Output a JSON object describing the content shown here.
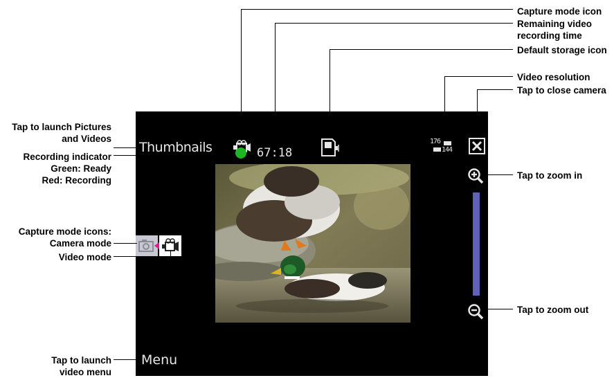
{
  "screen": {
    "thumbnails_label": "Thumbnails",
    "remaining_time": "67:18",
    "resolution_top": "176",
    "resolution_bottom": "144",
    "menu_label": "Menu",
    "recording_indicator_color": "#1db523",
    "zoom_bar_color": "#5f62b6"
  },
  "callouts": {
    "capture_mode_icon": "Capture mode icon",
    "remaining_time": "Remaining video\nrecording time",
    "default_storage": "Default storage icon",
    "video_resolution": "Video resolution",
    "close_camera": "Tap to close camera",
    "launch_pictures": "Tap to launch Pictures\nand Videos",
    "recording_indicator": "Recording indicator\nGreen: Ready\nRed: Recording",
    "capture_mode_icons": "Capture mode icons:\nCamera mode",
    "video_mode": "Video mode",
    "zoom_in": "Tap to zoom in",
    "zoom_out": "Tap to zoom out",
    "launch_menu": "Tap to launch\nvideo menu"
  },
  "icons": {
    "capture_mode": "video-camera-icon",
    "storage": "storage-card-icon",
    "resolution": "resolution-icon",
    "close": "close-icon",
    "zoom_in": "zoom-in-icon",
    "zoom_out": "zoom-out-icon",
    "camera_mode": "camera-icon",
    "video_mode": "video-camera-icon"
  }
}
